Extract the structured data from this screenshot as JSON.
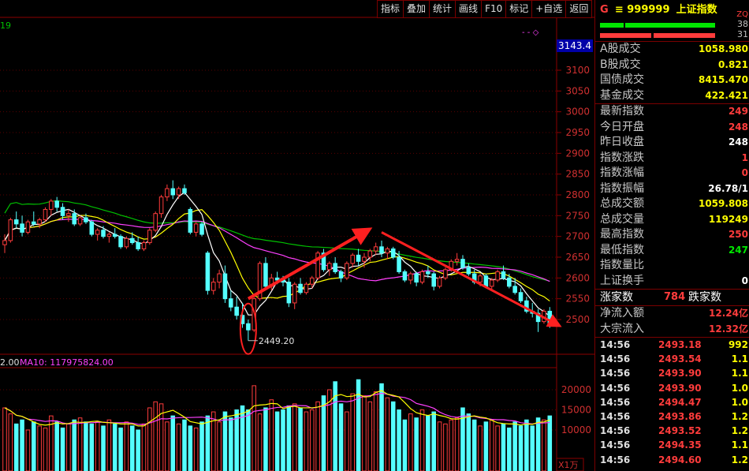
{
  "toolbar": [
    "指标",
    "叠加",
    "统计",
    "画线",
    "F10",
    "标记",
    "+自选",
    "返回"
  ],
  "chart_data": {
    "type": "candlestick",
    "corner_label": "19",
    "last_price_label": "3143.4",
    "y_ticks": [
      3100,
      3050,
      3000,
      2950,
      2900,
      2850,
      2800,
      2750,
      2700,
      2650,
      2600,
      2550,
      2500
    ],
    "low_annotation": {
      "value": 2449.2,
      "label": "2449.20"
    },
    "candles": [
      {
        "o": 2680,
        "h": 2705,
        "l": 2660,
        "c": 2690
      },
      {
        "o": 2690,
        "h": 2745,
        "l": 2685,
        "c": 2740
      },
      {
        "o": 2740,
        "h": 2760,
        "l": 2720,
        "c": 2730
      },
      {
        "o": 2730,
        "h": 2750,
        "l": 2700,
        "c": 2710
      },
      {
        "o": 2710,
        "h": 2740,
        "l": 2705,
        "c": 2735
      },
      {
        "o": 2735,
        "h": 2760,
        "l": 2725,
        "c": 2730
      },
      {
        "o": 2730,
        "h": 2745,
        "l": 2720,
        "c": 2740
      },
      {
        "o": 2740,
        "h": 2770,
        "l": 2735,
        "c": 2765
      },
      {
        "o": 2765,
        "h": 2790,
        "l": 2750,
        "c": 2785
      },
      {
        "o": 2785,
        "h": 2795,
        "l": 2760,
        "c": 2770
      },
      {
        "o": 2770,
        "h": 2780,
        "l": 2740,
        "c": 2750
      },
      {
        "o": 2750,
        "h": 2765,
        "l": 2735,
        "c": 2755
      },
      {
        "o": 2755,
        "h": 2765,
        "l": 2725,
        "c": 2730
      },
      {
        "o": 2730,
        "h": 2750,
        "l": 2725,
        "c": 2745
      },
      {
        "o": 2745,
        "h": 2755,
        "l": 2730,
        "c": 2735
      },
      {
        "o": 2735,
        "h": 2740,
        "l": 2700,
        "c": 2705
      },
      {
        "o": 2705,
        "h": 2720,
        "l": 2690,
        "c": 2715
      },
      {
        "o": 2715,
        "h": 2725,
        "l": 2695,
        "c": 2700
      },
      {
        "o": 2700,
        "h": 2710,
        "l": 2685,
        "c": 2705
      },
      {
        "o": 2705,
        "h": 2720,
        "l": 2695,
        "c": 2700
      },
      {
        "o": 2700,
        "h": 2705,
        "l": 2670,
        "c": 2675
      },
      {
        "o": 2675,
        "h": 2700,
        "l": 2670,
        "c": 2695
      },
      {
        "o": 2695,
        "h": 2710,
        "l": 2680,
        "c": 2685
      },
      {
        "o": 2685,
        "h": 2700,
        "l": 2665,
        "c": 2670
      },
      {
        "o": 2670,
        "h": 2690,
        "l": 2665,
        "c": 2685
      },
      {
        "o": 2685,
        "h": 2720,
        "l": 2680,
        "c": 2715
      },
      {
        "o": 2715,
        "h": 2760,
        "l": 2710,
        "c": 2755
      },
      {
        "o": 2755,
        "h": 2800,
        "l": 2745,
        "c": 2795
      },
      {
        "o": 2795,
        "h": 2825,
        "l": 2785,
        "c": 2815
      },
      {
        "o": 2815,
        "h": 2835,
        "l": 2790,
        "c": 2800
      },
      {
        "o": 2800,
        "h": 2820,
        "l": 2790,
        "c": 2815
      },
      {
        "o": 2815,
        "h": 2825,
        "l": 2800,
        "c": 2805
      },
      {
        "o": 2765,
        "h": 2770,
        "l": 2705,
        "c": 2710
      },
      {
        "o": 2710,
        "h": 2735,
        "l": 2700,
        "c": 2730
      },
      {
        "o": 2730,
        "h": 2735,
        "l": 2700,
        "c": 2705
      },
      {
        "o": 2660,
        "h": 2665,
        "l": 2560,
        "c": 2570
      },
      {
        "o": 2570,
        "h": 2600,
        "l": 2560,
        "c": 2590
      },
      {
        "o": 2590,
        "h": 2620,
        "l": 2575,
        "c": 2610
      },
      {
        "o": 2610,
        "h": 2630,
        "l": 2540,
        "c": 2550
      },
      {
        "o": 2550,
        "h": 2570,
        "l": 2520,
        "c": 2530
      },
      {
        "o": 2530,
        "h": 2555,
        "l": 2500,
        "c": 2510
      },
      {
        "o": 2510,
        "h": 2540,
        "l": 2480,
        "c": 2490
      },
      {
        "o": 2490,
        "h": 2500,
        "l": 2449.2,
        "c": 2475
      },
      {
        "o": 2475,
        "h": 2560,
        "l": 2470,
        "c": 2550
      },
      {
        "o": 2550,
        "h": 2640,
        "l": 2545,
        "c": 2635
      },
      {
        "o": 2635,
        "h": 2650,
        "l": 2575,
        "c": 2580
      },
      {
        "o": 2580,
        "h": 2610,
        "l": 2570,
        "c": 2600
      },
      {
        "o": 2600,
        "h": 2615,
        "l": 2585,
        "c": 2595
      },
      {
        "o": 2595,
        "h": 2605,
        "l": 2580,
        "c": 2590
      },
      {
        "o": 2590,
        "h": 2600,
        "l": 2530,
        "c": 2540
      },
      {
        "o": 2540,
        "h": 2590,
        "l": 2525,
        "c": 2585
      },
      {
        "o": 2585,
        "h": 2600,
        "l": 2560,
        "c": 2565
      },
      {
        "o": 2565,
        "h": 2590,
        "l": 2560,
        "c": 2585
      },
      {
        "o": 2585,
        "h": 2605,
        "l": 2575,
        "c": 2600
      },
      {
        "o": 2600,
        "h": 2665,
        "l": 2595,
        "c": 2660
      },
      {
        "o": 2660,
        "h": 2670,
        "l": 2615,
        "c": 2620
      },
      {
        "o": 2620,
        "h": 2640,
        "l": 2605,
        "c": 2635
      },
      {
        "o": 2635,
        "h": 2650,
        "l": 2610,
        "c": 2615
      },
      {
        "o": 2615,
        "h": 2620,
        "l": 2590,
        "c": 2600
      },
      {
        "o": 2600,
        "h": 2640,
        "l": 2595,
        "c": 2635
      },
      {
        "o": 2635,
        "h": 2660,
        "l": 2625,
        "c": 2655
      },
      {
        "o": 2655,
        "h": 2670,
        "l": 2630,
        "c": 2640
      },
      {
        "o": 2640,
        "h": 2660,
        "l": 2625,
        "c": 2650
      },
      {
        "o": 2650,
        "h": 2670,
        "l": 2640,
        "c": 2665
      },
      {
        "o": 2665,
        "h": 2685,
        "l": 2655,
        "c": 2675
      },
      {
        "o": 2675,
        "h": 2690,
        "l": 2650,
        "c": 2660
      },
      {
        "o": 2660,
        "h": 2675,
        "l": 2645,
        "c": 2670
      },
      {
        "o": 2670,
        "h": 2675,
        "l": 2645,
        "c": 2650
      },
      {
        "o": 2650,
        "h": 2665,
        "l": 2610,
        "c": 2615
      },
      {
        "o": 2615,
        "h": 2620,
        "l": 2590,
        "c": 2595
      },
      {
        "o": 2595,
        "h": 2615,
        "l": 2585,
        "c": 2610
      },
      {
        "o": 2610,
        "h": 2615,
        "l": 2580,
        "c": 2590
      },
      {
        "o": 2590,
        "h": 2620,
        "l": 2585,
        "c": 2615
      },
      {
        "o": 2615,
        "h": 2630,
        "l": 2600,
        "c": 2610
      },
      {
        "o": 2610,
        "h": 2615,
        "l": 2570,
        "c": 2580
      },
      {
        "o": 2580,
        "h": 2605,
        "l": 2575,
        "c": 2600
      },
      {
        "o": 2600,
        "h": 2625,
        "l": 2595,
        "c": 2620
      },
      {
        "o": 2620,
        "h": 2645,
        "l": 2615,
        "c": 2640
      },
      {
        "o": 2640,
        "h": 2660,
        "l": 2630,
        "c": 2645
      },
      {
        "o": 2645,
        "h": 2655,
        "l": 2620,
        "c": 2625
      },
      {
        "o": 2625,
        "h": 2635,
        "l": 2605,
        "c": 2610
      },
      {
        "o": 2610,
        "h": 2620,
        "l": 2585,
        "c": 2590
      },
      {
        "o": 2590,
        "h": 2610,
        "l": 2580,
        "c": 2605
      },
      {
        "o": 2605,
        "h": 2610,
        "l": 2575,
        "c": 2580
      },
      {
        "o": 2580,
        "h": 2600,
        "l": 2570,
        "c": 2595
      },
      {
        "o": 2595,
        "h": 2620,
        "l": 2590,
        "c": 2615
      },
      {
        "o": 2615,
        "h": 2630,
        "l": 2595,
        "c": 2600
      },
      {
        "o": 2600,
        "h": 2610,
        "l": 2575,
        "c": 2580
      },
      {
        "o": 2580,
        "h": 2600,
        "l": 2560,
        "c": 2565
      },
      {
        "o": 2565,
        "h": 2575,
        "l": 2540,
        "c": 2545
      },
      {
        "o": 2545,
        "h": 2555,
        "l": 2515,
        "c": 2520
      },
      {
        "o": 2520,
        "h": 2540,
        "l": 2505,
        "c": 2515
      },
      {
        "o": 2515,
        "h": 2525,
        "l": 2470,
        "c": 2495
      },
      {
        "o": 2495,
        "h": 2525,
        "l": 2490,
        "c": 2520
      },
      {
        "o": 2520,
        "h": 2530,
        "l": 2480,
        "c": 2490
      }
    ],
    "volume_label": "MA10: 117975824.00",
    "volume_label_left": "2.00",
    "volume_ticks": [
      20000,
      15000,
      10000
    ],
    "volume_unit": "X1万",
    "volumes": [
      15500,
      14000,
      11500,
      12500,
      10000,
      12000,
      11000,
      10500,
      13500,
      12000,
      10500,
      11500,
      12500,
      13000,
      12000,
      11500,
      12000,
      11000,
      12500,
      11500,
      10500,
      12000,
      11000,
      10000,
      11500,
      15500,
      17000,
      16500,
      12000,
      13500,
      11500,
      12500,
      11000,
      10500,
      12000,
      13500,
      14500,
      12000,
      14500,
      13000,
      15000,
      16000,
      15000,
      21000,
      14000,
      15500,
      17500,
      14500,
      15000,
      16000,
      16500,
      15500,
      14500,
      15000,
      17000,
      18500,
      20000,
      22000,
      16500,
      14500,
      19000,
      22500,
      18500,
      17000,
      19500,
      21500,
      18000,
      17000,
      15000,
      12500,
      14000,
      13000,
      15000,
      13500,
      14500,
      12000,
      11500,
      12500,
      13000,
      15500,
      14000,
      12500,
      11000,
      12000,
      12500,
      11000,
      11500,
      10500,
      12000,
      11000,
      12500,
      11000,
      13000,
      12500,
      13500,
      11500
    ],
    "arrows": [
      {
        "from": [
          42,
          2550
        ],
        "to": [
          62,
          2710
        ]
      },
      {
        "from": [
          65,
          2710
        ],
        "to": [
          95,
          2490
        ]
      }
    ]
  },
  "panel": {
    "g": "G",
    "code": "≡ 999999",
    "name": "上证指数",
    "zq": "ZQ",
    "bar_top": {
      "num": "38"
    },
    "bar_bottom": {
      "num": "31"
    },
    "volume_rows": [
      {
        "label": "A股成交",
        "value": "1058.980"
      },
      {
        "label": "B股成交",
        "value": "0.821"
      },
      {
        "label": "国债成交",
        "value": "8415.470"
      },
      {
        "label": "基金成交",
        "value": "422.421"
      }
    ],
    "index_rows": [
      {
        "label": "最新指数",
        "value": "249",
        "color": "c-r"
      },
      {
        "label": "今日开盘",
        "value": "248",
        "color": "c-r"
      },
      {
        "label": "昨日收盘",
        "value": "248",
        "color": "c-w"
      },
      {
        "label": "指数涨跌",
        "value": "1",
        "color": "c-r"
      },
      {
        "label": "指数涨幅",
        "value": "0",
        "color": "c-r"
      },
      {
        "label": "指数振幅",
        "value": "26.78/1",
        "color": "c-w"
      },
      {
        "label": "总成交额",
        "value": "1059.808",
        "color": "c-y"
      },
      {
        "label": "总成交量",
        "value": "119249",
        "color": "c-y"
      },
      {
        "label": "最高指数",
        "value": "250",
        "color": "c-r"
      },
      {
        "label": "最低指数",
        "value": "247",
        "color": "c-g"
      },
      {
        "label": "指数量比",
        "value": "",
        "color": "c-w"
      },
      {
        "label": "上证换手",
        "value": "0",
        "color": "c-w"
      }
    ],
    "updown": {
      "up_label": "涨家数",
      "up_value": "784",
      "down_label": "跌家数"
    },
    "flow_rows": [
      {
        "label": "净流入额",
        "value": "12.24亿"
      },
      {
        "label": "大宗流入",
        "value": "12.32亿"
      }
    ],
    "trades": [
      {
        "t": "14:56",
        "p": "2493.18",
        "v": "992"
      },
      {
        "t": "14:56",
        "p": "2493.54",
        "v": "1.1"
      },
      {
        "t": "14:56",
        "p": "2493.90",
        "v": "1.1"
      },
      {
        "t": "14:56",
        "p": "2493.90",
        "v": "1.0"
      },
      {
        "t": "14:56",
        "p": "2494.47",
        "v": "1.0"
      },
      {
        "t": "14:56",
        "p": "2493.86",
        "v": "1.2"
      },
      {
        "t": "14:56",
        "p": "2493.52",
        "v": "1.2"
      },
      {
        "t": "14:56",
        "p": "2494.35",
        "v": "1.1"
      },
      {
        "t": "14:56",
        "p": "2494.60",
        "v": "1.2"
      }
    ]
  }
}
